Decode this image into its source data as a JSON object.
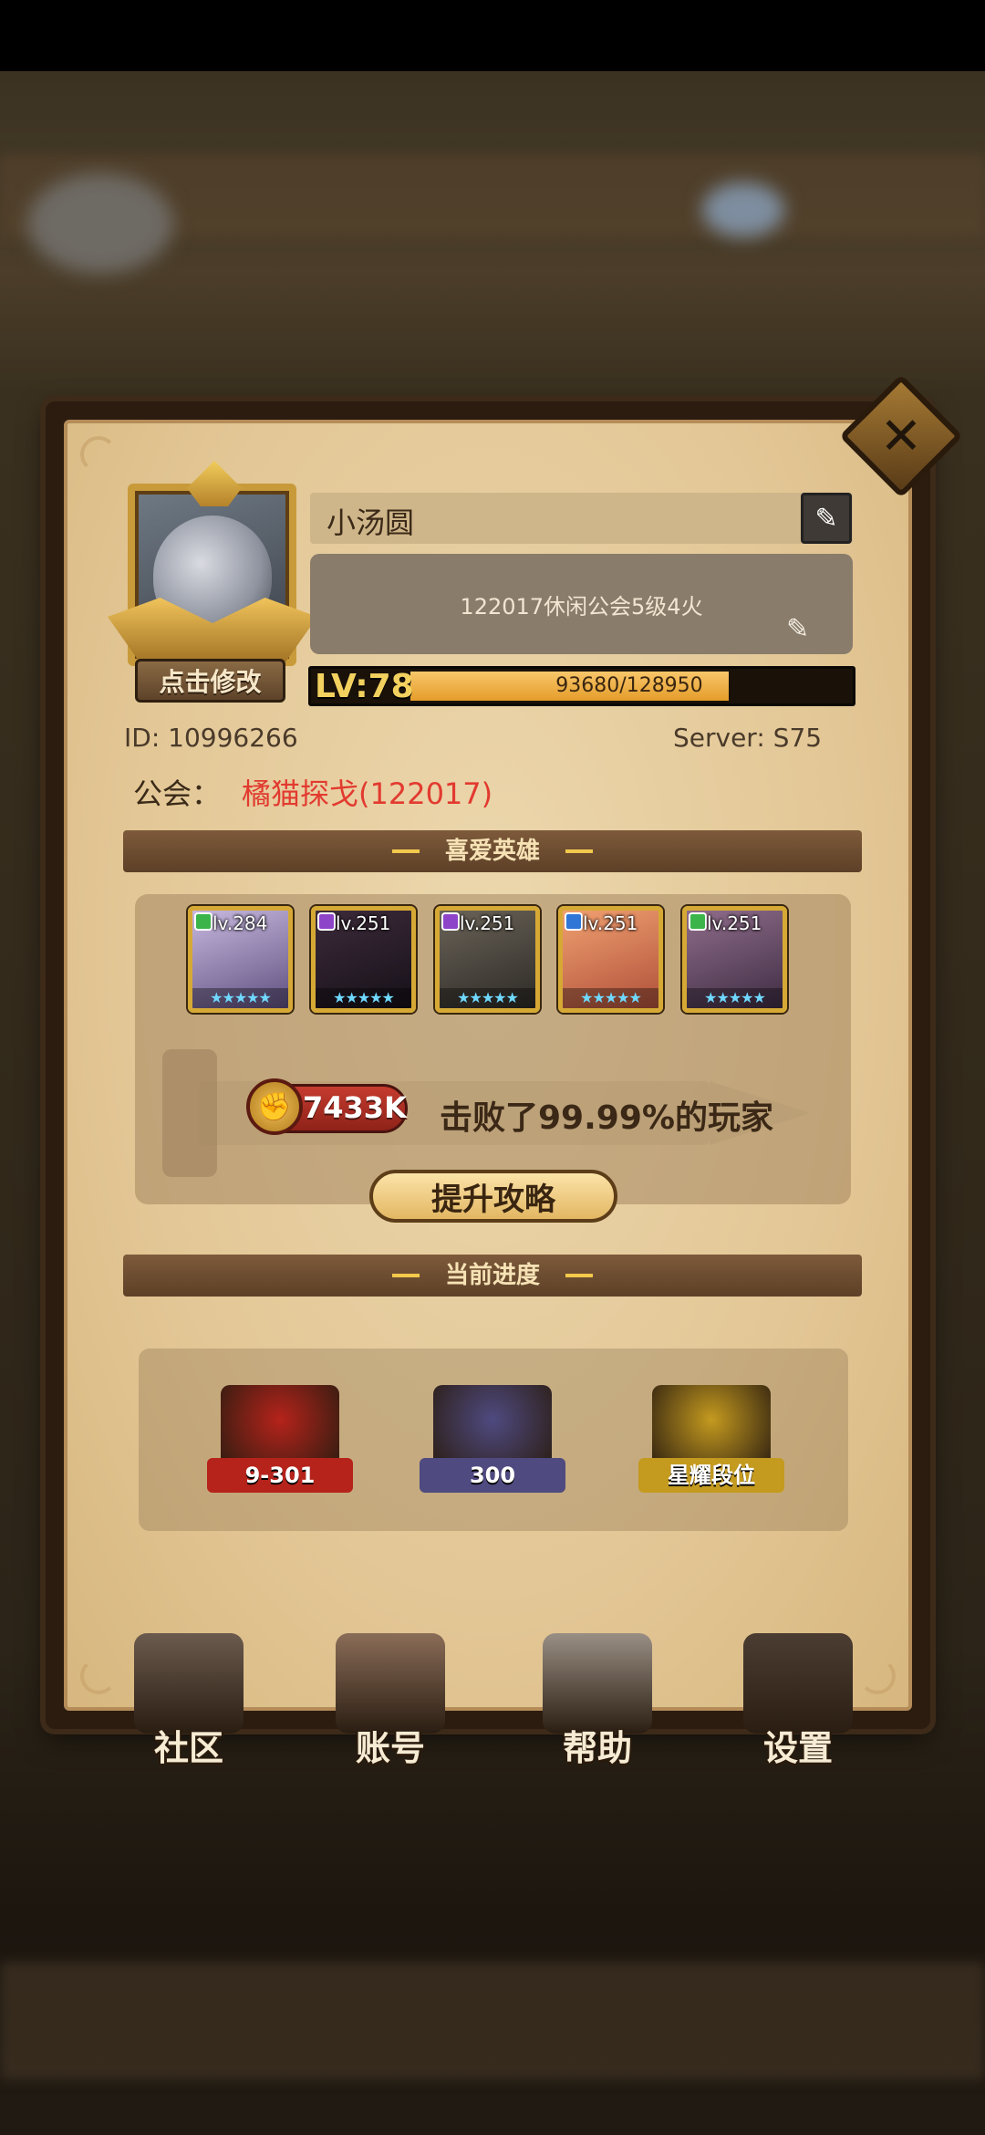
{
  "profile": {
    "edit_avatar_label": "点击修改",
    "name": "小汤圆",
    "signature": "122017休闲公会5级4火",
    "level_label": "LV:78",
    "exp_text": "93680/128950",
    "exp_progress": 0.7265,
    "id_label": "ID:",
    "id_value": "10996266",
    "server_label": "Server:",
    "server_value": "S75",
    "guild_label": "公会：",
    "guild_value": "橘猫探戈(122017)"
  },
  "favorite_heroes": {
    "title": "喜爱英雄",
    "heroes": [
      {
        "level": "lv.284",
        "element_color": "#3bb54a"
      },
      {
        "level": "lv.251",
        "element_color": "#8e44c9"
      },
      {
        "level": "lv.251",
        "element_color": "#8e44c9"
      },
      {
        "level": "lv.251",
        "element_color": "#2f76d6"
      },
      {
        "level": "lv.251",
        "element_color": "#3bb54a"
      }
    ],
    "stars": "★★★★★",
    "power_value": "7433K",
    "beat_text": "击败了99.99%的玩家",
    "strategy_button": "提升攻略"
  },
  "current_progress": {
    "title": "当前进度",
    "items": [
      {
        "label": "9-301",
        "icon": "campaign-book-icon",
        "color": "#b5231b"
      },
      {
        "label": "300",
        "icon": "tower-sword-icon",
        "color": "#4f4a80"
      },
      {
        "label": "星耀段位",
        "icon": "arena-rank-icon",
        "color": "#c49a1f"
      }
    ]
  },
  "bottom_nav": [
    {
      "label": "社区",
      "icon": "castle-icon"
    },
    {
      "label": "账号",
      "icon": "account-card-icon"
    },
    {
      "label": "帮助",
      "icon": "chat-bubble-icon"
    },
    {
      "label": "设置",
      "icon": "gear-icon"
    }
  ],
  "close_glyph": "✕",
  "pencil_glyph": "✎",
  "fist_glyph": "✊"
}
